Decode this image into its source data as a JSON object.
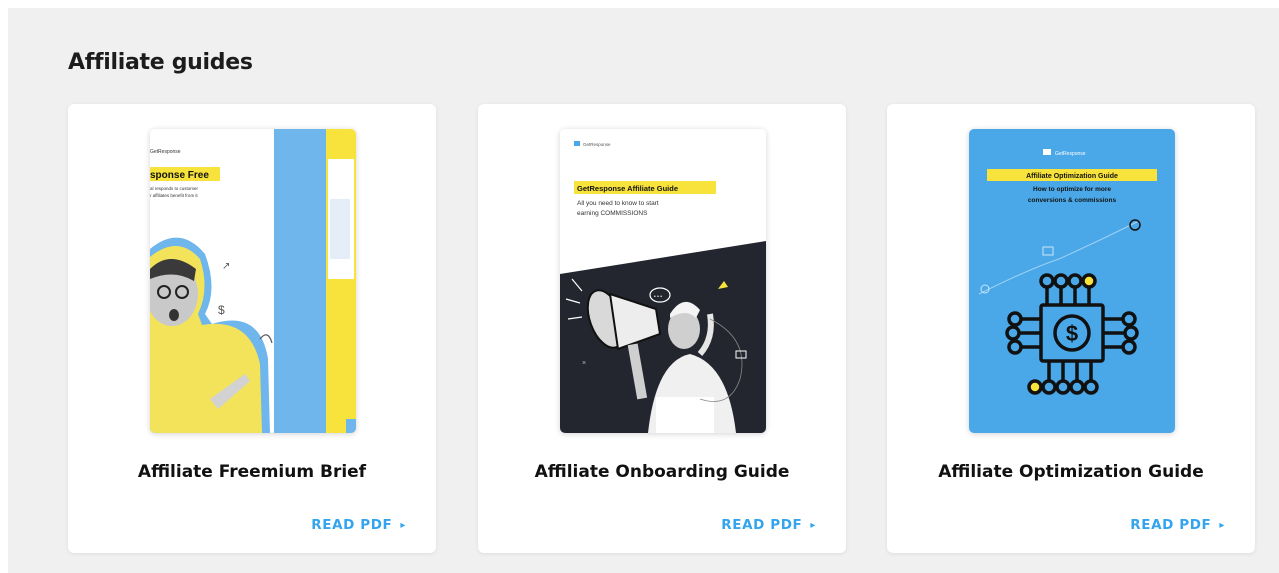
{
  "section": {
    "title": "Affiliate guides"
  },
  "cards": [
    {
      "title": "Affiliate Freemium Brief",
      "link_label": "READ PDF",
      "cover": {
        "brand": "GetResponse",
        "headline": "sponse Free",
        "line1": "al responds to customer",
        "line2": "r affiliates benefit from it"
      }
    },
    {
      "title": "Affiliate Onboarding Guide",
      "link_label": "READ PDF",
      "cover": {
        "brand": "GetResponse",
        "headline": "GetResponse Affiliate Guide",
        "line1": "All you need to know to start",
        "line2": "earning COMMISSIONS"
      }
    },
    {
      "title": "Affiliate Optimization Guide",
      "link_label": "READ PDF",
      "cover": {
        "brand": "GetResponse",
        "headline": "Affiliate Optimization Guide",
        "line1": "How to optimize for more",
        "line2": "conversions & commissions"
      }
    }
  ],
  "icons": {
    "chevron": "▸"
  },
  "colors": {
    "accent": "#34a4ee",
    "panel": "#f0f0f0",
    "yellow": "#f7e33b",
    "cover_blue": "#4aa8e8",
    "dark": "#23262f"
  }
}
